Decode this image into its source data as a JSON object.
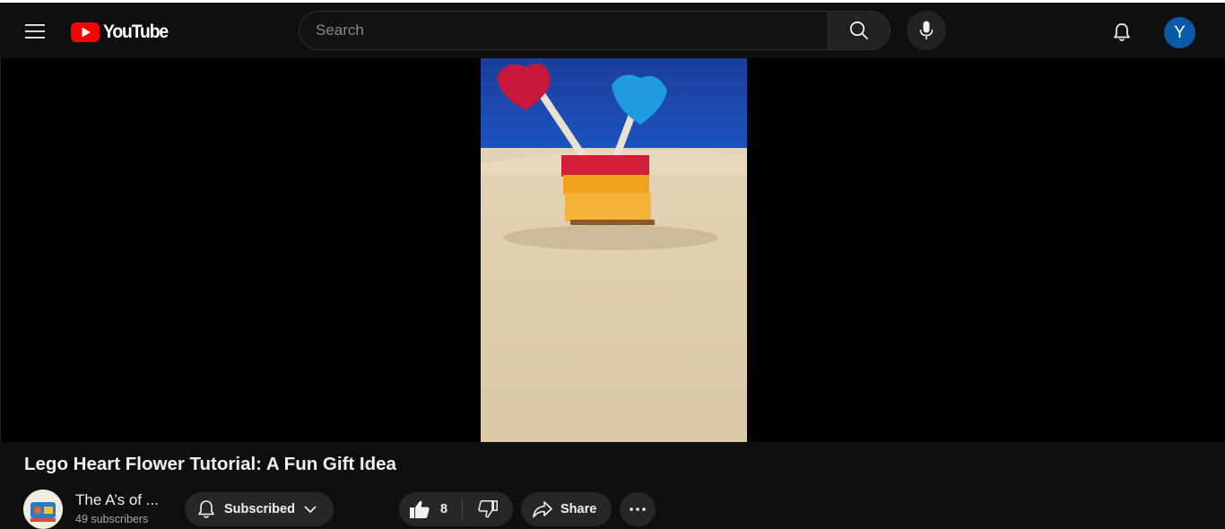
{
  "header": {
    "logo_text": "YouTube",
    "logo_color": "#ff0000",
    "search_placeholder": "Search",
    "avatar_letter": "Y",
    "avatar_color": "#0a5aa5",
    "icons": [
      "menu-icon",
      "youtube-logo-icon",
      "search-icon",
      "microphone-icon",
      "bell-icon"
    ]
  },
  "video": {
    "title": "Lego Heart Flower Tutorial: A Fun Gift Idea",
    "thumbnail_description_icon": "video-frame"
  },
  "channel": {
    "name": "The A’s of ...",
    "subscribers": "49 subscribers"
  },
  "actions": {
    "subscribe_label": "Subscribed",
    "like_count": "8",
    "share_label": "Share",
    "more_icon": "more-horizontal-icon"
  }
}
